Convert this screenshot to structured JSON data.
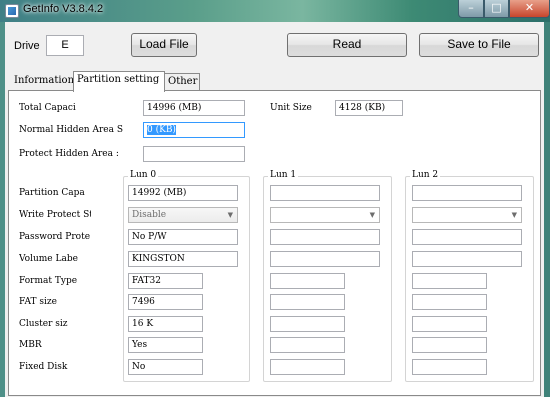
{
  "window": {
    "title": "GetInfo V3.8.4.2",
    "minimize": "–",
    "maximize": "□",
    "close": "✕"
  },
  "toolbar": {
    "drive_label": "Drive",
    "drive_value": "E",
    "load_file": "Load File",
    "read": "Read",
    "save_to_file": "Save to File"
  },
  "tabs": [
    "Information",
    "Partition setting",
    "Other"
  ],
  "partition": {
    "total_capacity_label": "Total Capaci",
    "total_capacity_value": "14996 (MB)",
    "unit_size_label": "Unit Size",
    "unit_size_value": "4128 (KB)",
    "normal_hidden_label": "Normal Hidden Area S",
    "normal_hidden_value": "0 (KB)",
    "protect_hidden_label": "Protect Hidden Area :",
    "protect_hidden_value": ""
  },
  "row_labels": {
    "partition_capacity": "Partition Capa",
    "write_protect": "Write Protect St",
    "password_protect": "Password Prote",
    "volume_label": "Volume Labe",
    "format_type": "Format Type",
    "fat_size": "FAT size",
    "cluster_size": "Cluster siz",
    "mbr": "MBR",
    "fixed_disk": "Fixed Disk"
  },
  "luns": [
    {
      "title": "Lun 0",
      "partition_capacity": "14992 (MB)",
      "write_protect": "Disable",
      "password_protect": "No P/W",
      "volume_label": "KINGSTON",
      "format_type": "FAT32",
      "fat_size": "7496",
      "cluster_size": "16 K",
      "mbr": "Yes",
      "fixed_disk": "No"
    },
    {
      "title": "Lun 1",
      "partition_capacity": "",
      "write_protect": "",
      "password_protect": "",
      "volume_label": "",
      "format_type": "",
      "fat_size": "",
      "cluster_size": "",
      "mbr": "",
      "fixed_disk": ""
    },
    {
      "title": "Lun 2",
      "partition_capacity": "",
      "write_protect": "",
      "password_protect": "",
      "volume_label": "",
      "format_type": "",
      "fat_size": "",
      "cluster_size": "",
      "mbr": "",
      "fixed_disk": ""
    }
  ]
}
